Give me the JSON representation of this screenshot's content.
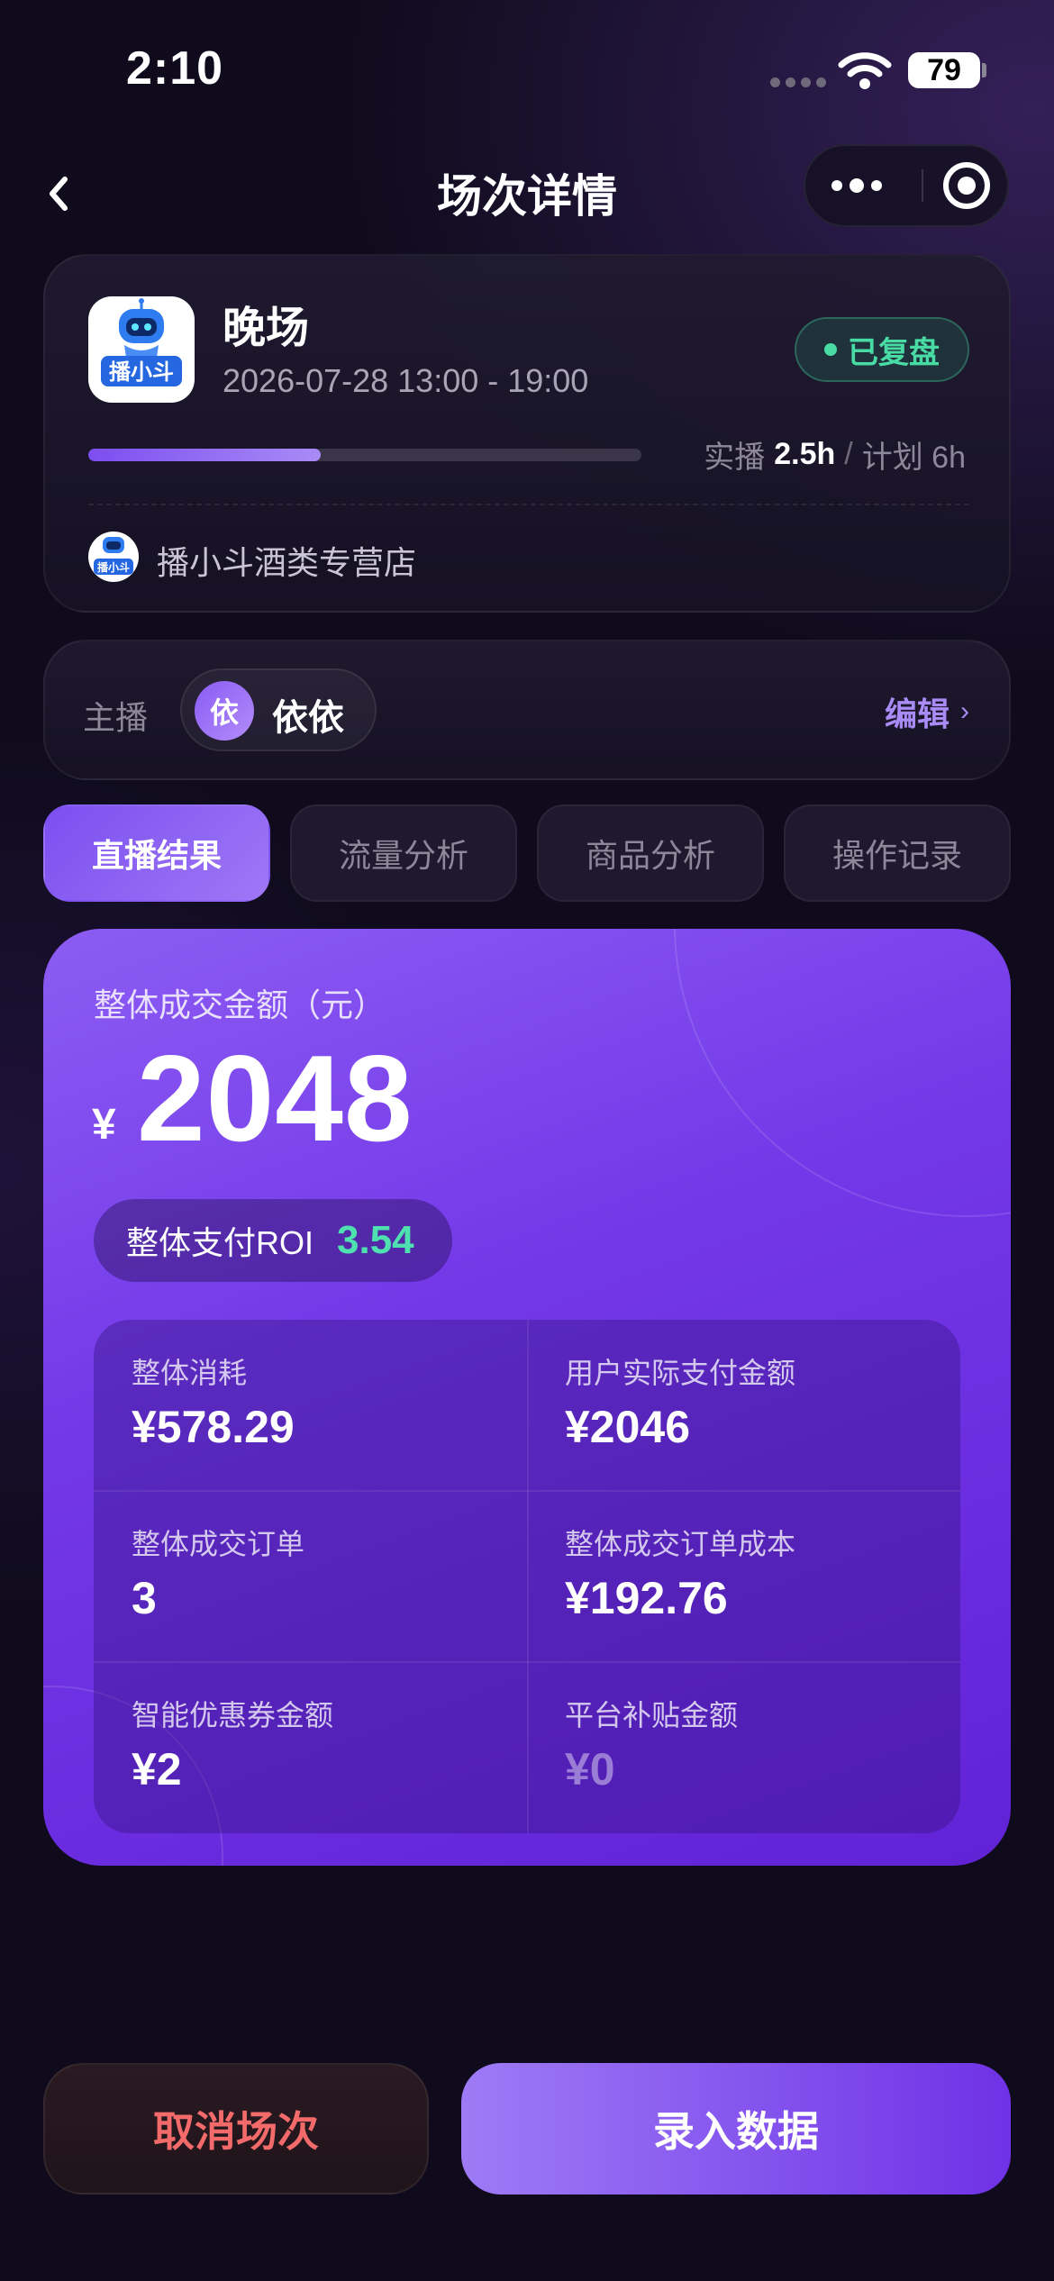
{
  "status_bar": {
    "time": "2:10",
    "battery": "79"
  },
  "nav": {
    "title": "场次详情",
    "back_icon": "chevron-left-icon",
    "more_icon": "more-dots-icon",
    "close_icon": "record-circle-icon"
  },
  "session": {
    "logo_text": "播小斗",
    "name": "晚场",
    "time_range": "2026-07-28 13:00 - 19:00",
    "status": "已复盘",
    "progress_fraction": 0.42,
    "actual_label": "实播",
    "actual_value": "2.5h",
    "separator": "/",
    "plan_label": "计划 6h",
    "shop_avatar_text": "播小斗",
    "shop_name": "播小斗酒类专营店"
  },
  "anchor": {
    "label": "主播",
    "avatar_char": "依",
    "name": "依依",
    "edit_label": "编辑",
    "edit_chevron": "›"
  },
  "tabs": [
    {
      "label": "直播结果",
      "active": true
    },
    {
      "label": "流量分析",
      "active": false
    },
    {
      "label": "商品分析",
      "active": false
    },
    {
      "label": "操作记录",
      "active": false
    }
  ],
  "result": {
    "label": "整体成交金额（元）",
    "currency": "¥",
    "amount": "2048",
    "roi_label": "整体支付ROI",
    "roi_value": "3.54",
    "metrics": [
      {
        "label": "整体消耗",
        "value": "¥578.29"
      },
      {
        "label": "用户实际支付金额",
        "value": "¥2046"
      },
      {
        "label": "整体成交订单",
        "value": "3"
      },
      {
        "label": "整体成交订单成本",
        "value": "¥192.76"
      },
      {
        "label": "智能优惠券金额",
        "value": "¥2"
      },
      {
        "label": "平台补贴金额",
        "value": "¥0"
      }
    ]
  },
  "actions": {
    "cancel_label": "取消场次",
    "enter_label": "录入数据"
  },
  "colors": {
    "accent": "#7b4ff0",
    "success": "#48dca4",
    "danger": "#f26a6a",
    "background": "#0f0b1c"
  }
}
